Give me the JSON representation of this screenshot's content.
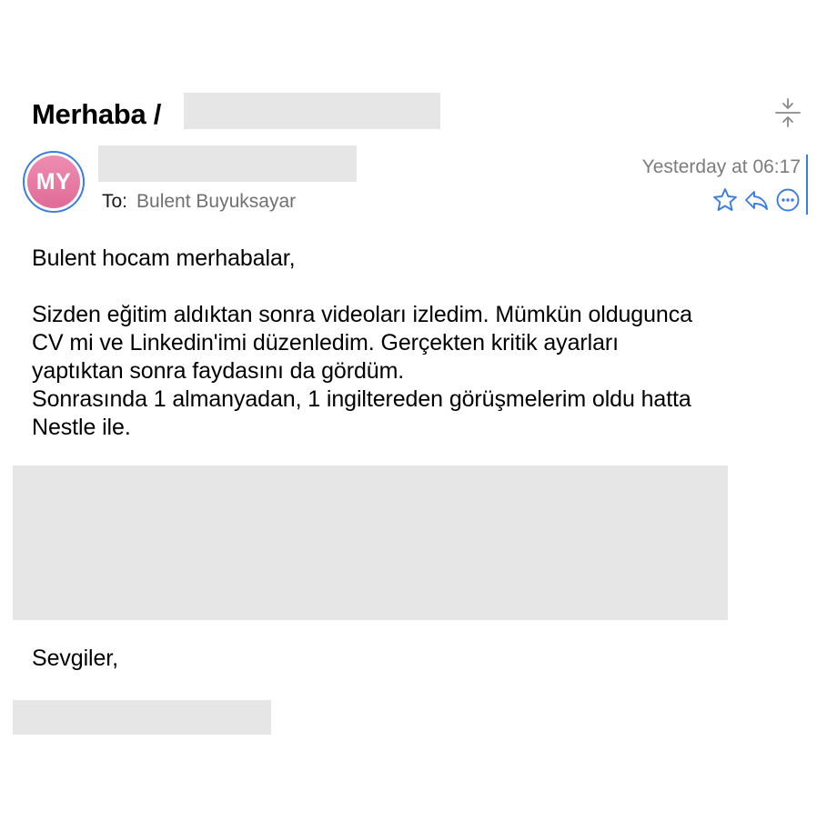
{
  "header": {
    "subject_prefix": "Merhaba /",
    "sender_initials": "MY",
    "to_label": "To:",
    "to_name": "Bulent Buyuksayar",
    "timestamp": "Yesterday at 06:17"
  },
  "icons": {
    "expand": "collapse-expand-icon",
    "star": "star-icon",
    "reply": "reply-icon",
    "more": "more-options-icon"
  },
  "colors": {
    "accent": "#3b7de0",
    "avatar": "#e8779f",
    "redaction": "#e6e6e6"
  },
  "message": {
    "greeting": "Bulent hocam merhabalar,",
    "lines": [
      "Sizden eğitim aldıktan sonra videoları izledim. Mümkün oldugunca",
      "CV mi ve Linkedin'imi düzenledim. Gerçekten kritik ayarları",
      "yaptıktan sonra faydasını da gördüm.",
      "Sonrasında 1 almanyadan, 1 ingiltereden görüşmelerim oldu hatta",
      "Nestle ile."
    ],
    "closing": "Sevgiler,"
  }
}
